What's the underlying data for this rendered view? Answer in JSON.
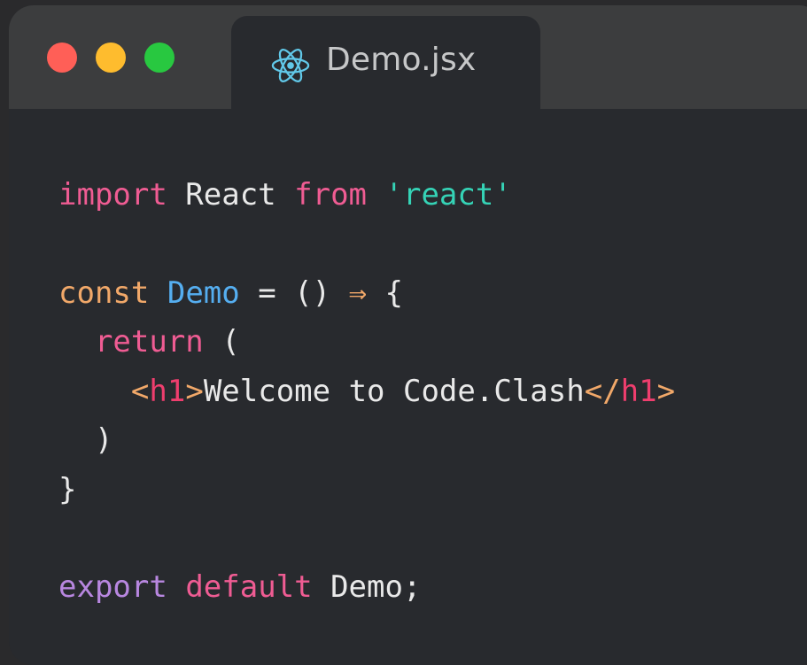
{
  "window": {
    "tab_title": "Demo.jsx",
    "tab_icon": "react-icon",
    "traffic_lights": {
      "close_color": "#ff5f57",
      "minimize_color": "#febc2e",
      "zoom_color": "#28c840"
    }
  },
  "code": {
    "line1": {
      "t1": "import",
      "t2": " React ",
      "t3": "from",
      "t4": " ",
      "t5": "'react'"
    },
    "line2": {
      "t1": "const",
      "t2": " ",
      "t3": "Demo",
      "t4": " = () ",
      "t5": "⇒",
      "t6": " {"
    },
    "line3": {
      "t1": "  ",
      "t2": "return",
      "t3": " ("
    },
    "line4": {
      "t1": "    ",
      "t2": "<",
      "t3": "h1",
      "t4": ">",
      "t5": "Welcome to Code.Clash",
      "t6": "</",
      "t7": "h1",
      "t8": ">"
    },
    "line5": {
      "t1": "  )"
    },
    "line6": {
      "t1": "}"
    },
    "line7": {
      "t1": "export",
      "t2": " ",
      "t3": "default",
      "t4": " Demo;"
    }
  },
  "colors": {
    "keyword_pink": "#ef5c93",
    "keyword_orange": "#f1a869",
    "keyword_purple": "#b887e0",
    "string": "#35d3b6",
    "identifier": "#55aef0",
    "jsx_tag": "#ef3e6e",
    "background": "#282a2e",
    "titlebar": "#3c3d3e"
  }
}
